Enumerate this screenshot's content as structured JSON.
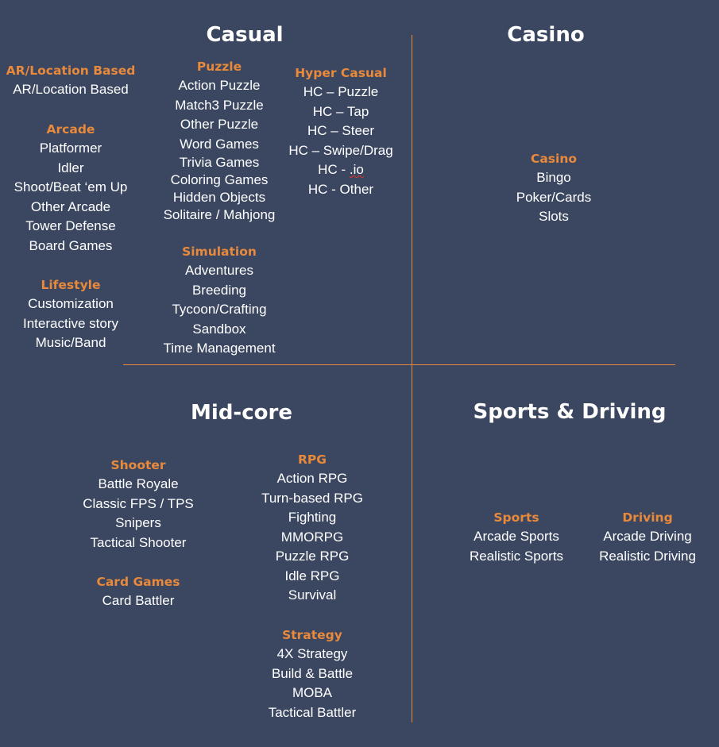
{
  "quadrants": {
    "casual": {
      "title": "Casual",
      "groups": [
        {
          "title": "AR/Location Based",
          "items": [
            "AR/Location Based"
          ]
        },
        {
          "title": "Arcade",
          "items": [
            "Platformer",
            "Idler",
            "Shoot/Beat ‘em Up",
            "Other Arcade",
            "Tower Defense",
            "Board Games"
          ]
        },
        {
          "title": "Lifestyle",
          "items": [
            "Customization",
            "Interactive story",
            "Music/Band"
          ]
        },
        {
          "title": "Puzzle",
          "items": [
            "Action Puzzle",
            "Match3 Puzzle",
            "Other Puzzle",
            "Word Games",
            "Trivia Games",
            "Coloring Games",
            "Hidden Objects",
            "Solitaire / Mahjong"
          ]
        },
        {
          "title": "Simulation",
          "items": [
            "Adventures",
            "Breeding",
            "Tycoon/Crafting",
            "Sandbox",
            "Time Management"
          ]
        },
        {
          "title": "Hyper Casual",
          "items": [
            "HC – Puzzle",
            "HC – Tap",
            "HC – Steer",
            "HC – Swipe/Drag",
            "HC - .io",
            "HC - Other"
          ]
        }
      ]
    },
    "casino": {
      "title": "Casino",
      "groups": [
        {
          "title": "Casino",
          "items": [
            "Bingo",
            "Poker/Cards",
            "Slots"
          ]
        }
      ]
    },
    "midcore": {
      "title": "Mid-core",
      "groups": [
        {
          "title": "Shooter",
          "items": [
            "Battle Royale",
            "Classic FPS / TPS",
            "Snipers",
            "Tactical Shooter"
          ]
        },
        {
          "title": "Card Games",
          "items": [
            "Card Battler"
          ]
        },
        {
          "title": "RPG",
          "items": [
            "Action RPG",
            "Turn-based RPG",
            "Fighting",
            "MMORPG",
            "Puzzle RPG",
            "Idle RPG",
            "Survival"
          ]
        },
        {
          "title": "Strategy",
          "items": [
            "4X Strategy",
            "Build & Battle",
            "MOBA",
            "Tactical Battler"
          ]
        }
      ]
    },
    "sports": {
      "title": "Sports & Driving",
      "groups": [
        {
          "title": "Sports",
          "items": [
            "Arcade Sports",
            "Realistic Sports"
          ]
        },
        {
          "title": "Driving",
          "items": [
            "Arcade Driving",
            "Realistic Driving"
          ]
        }
      ]
    }
  },
  "colors": {
    "background": "#3b4760",
    "accent": "#e8893b",
    "text": "#ffffff"
  }
}
